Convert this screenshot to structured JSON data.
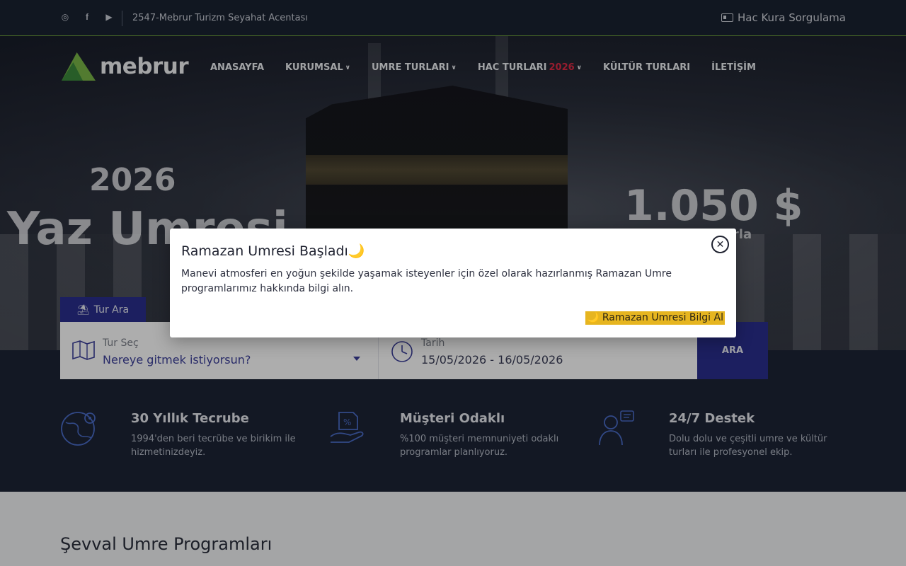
{
  "topbar": {
    "agency": "2547-Mebrur Turizm Seyahat Acentası",
    "hac_kura": "Hac Kura Sorgulama",
    "social": [
      "instagram-icon",
      "facebook-icon",
      "youtube-icon"
    ]
  },
  "logo": {
    "word": "mebrur"
  },
  "nav": {
    "items": [
      {
        "label": "ANASAYFA"
      },
      {
        "label": "KURUMSAL"
      },
      {
        "label": "UMRE TURLARI"
      },
      {
        "label": "HAC TURLARI",
        "accent": "2026"
      },
      {
        "label": "KÜLTÜR TURLARI"
      },
      {
        "label": "İLETİŞİM"
      }
    ]
  },
  "hero": {
    "year": "2026",
    "headline": "Yaz Umresi",
    "price": "1.050 $",
    "price_sub": "tlarla"
  },
  "search": {
    "tab_label": "Tur Ara",
    "tour_label": "Tur Seç",
    "tour_placeholder": "Nereye gitmek istiyorsun?",
    "date_label": "Tarih",
    "date_value": "15/05/2026 - 16/05/2026",
    "button": "ARA"
  },
  "features": [
    {
      "icon": "globe-map-icon",
      "title": "30 Yıllık Tecrube",
      "text": "1994'den beri tecrübe ve birikim ile hizmetinizdeyiz."
    },
    {
      "icon": "hand-discount-icon",
      "title": "Müşteri Odaklı",
      "text": "%100 müşteri memnuniyeti odaklı programlar planlıyoruz."
    },
    {
      "icon": "support-agent-icon",
      "title": "24/7 Destek",
      "text": "Dolu dolu ve çeşitli umre ve kültür turları ile profesyonel ekip."
    }
  ],
  "section": {
    "title": "Şevval Umre Programları"
  },
  "modal": {
    "title": "Ramazan Umresi Başladı🌙",
    "body": "Manevi atmosferi en yoğun şekilde yaşamak isteyenler için özel olarak hazırlanmış Ramazan Umre programlarımız hakkında bilgi alın.",
    "cta": "🌙 Ramazan Umresi Bilgi Al"
  },
  "colors": {
    "primary": "#2a2e8e",
    "accent_red": "#e02a45",
    "cta_yellow": "#e6b520",
    "logo_green": "#7ab648",
    "dark_bg": "#1c2436"
  }
}
